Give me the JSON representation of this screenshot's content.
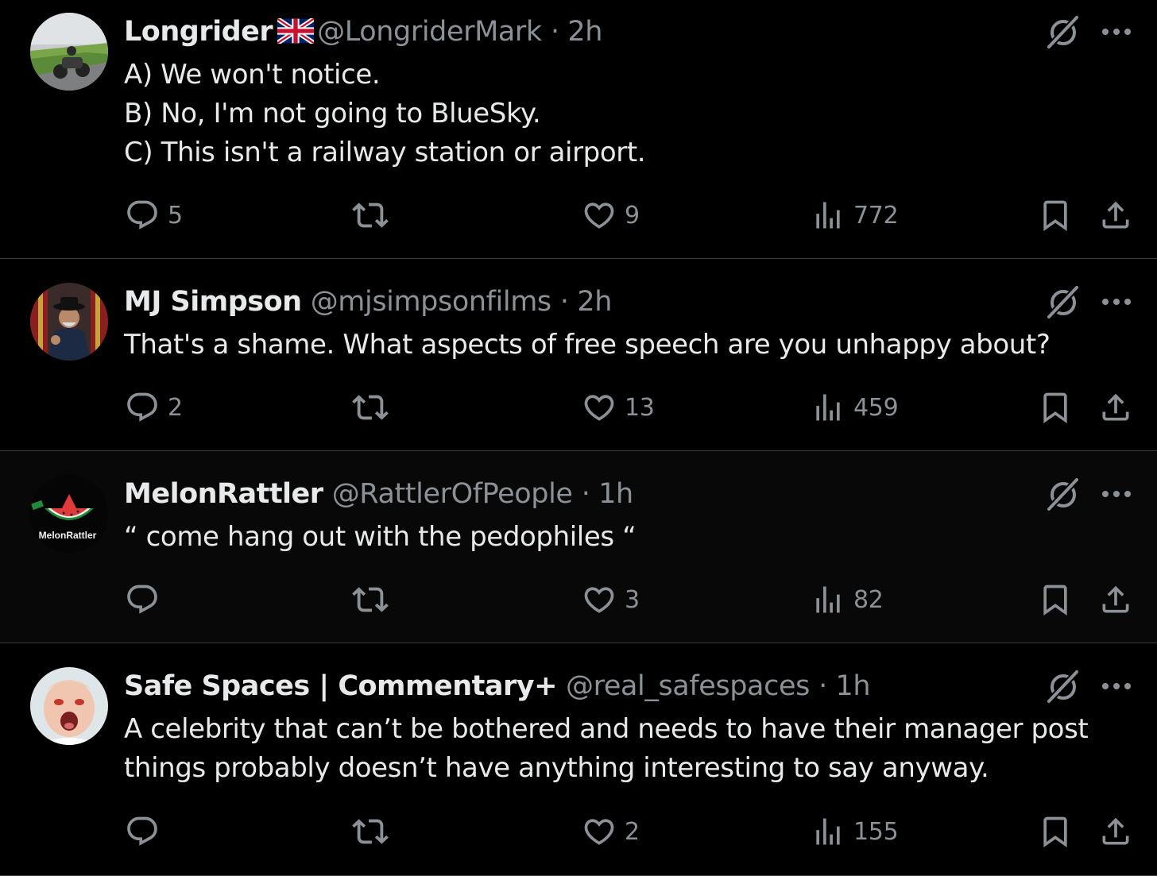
{
  "colors": {
    "background": "#000000",
    "highlight_background": "#080808",
    "text_primary": "#e7e9ea",
    "text_secondary": "#8b9196",
    "divider": "#3a3d40"
  },
  "icons": {
    "reply": "speech-bubble",
    "repost": "repost-arrows",
    "like": "heart",
    "views": "bar-chart",
    "bookmark": "bookmark",
    "share": "upload-arrow",
    "grok": "slashed-circle",
    "more": "three-dots"
  },
  "tweets": [
    {
      "name": "Longrider",
      "flag": "union-jack-flag",
      "handle": "@LongriderMark",
      "time": "· 2h",
      "lines": [
        "A) We won't notice.",
        "B) No, I'm not going to BlueSky.",
        "C) This isn't a railway station or airport."
      ],
      "replies": "5",
      "reposts": "",
      "likes": "9",
      "views": "772"
    },
    {
      "name": "MJ Simpson",
      "handle": "@mjsimpsonfilms",
      "time": "· 2h",
      "lines": [
        "That's a shame. What aspects of free speech are you unhappy about?"
      ],
      "replies": "2",
      "reposts": "",
      "likes": "13",
      "views": "459"
    },
    {
      "name": "MelonRattler",
      "handle": "@RattlerOfPeople",
      "time": "· 1h",
      "avatar_text": "MelonRattler",
      "lines": [
        "“ come hang out with the pedophiles “"
      ],
      "replies": "",
      "reposts": "",
      "likes": "3",
      "views": "82"
    },
    {
      "name": "Safe Spaces | Commentary+",
      "handle": "@real_safespaces",
      "time": "· 1h",
      "lines": [
        "A celebrity that can’t be bothered and needs to have their manager post",
        "things probably doesn’t have anything interesting to say anyway."
      ],
      "replies": "",
      "reposts": "",
      "likes": "2",
      "views": "155"
    }
  ]
}
